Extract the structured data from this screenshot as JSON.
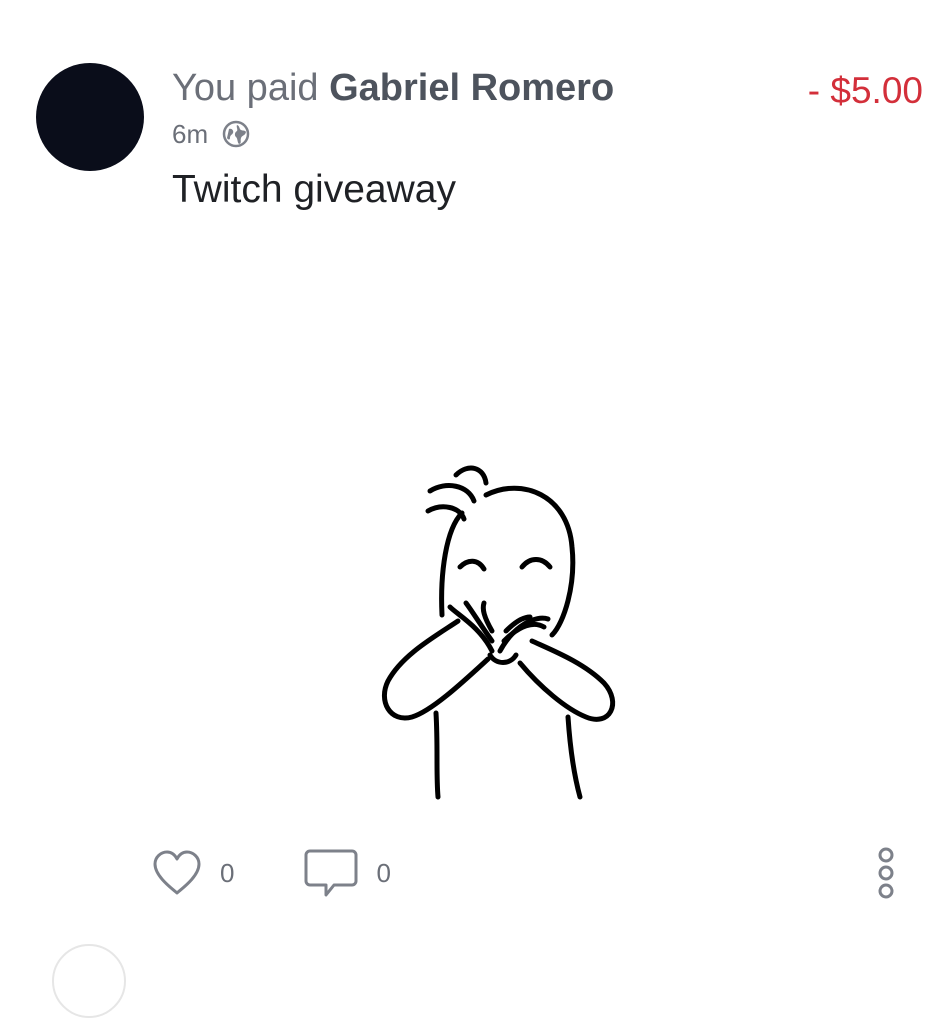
{
  "payment": {
    "verb": "You paid",
    "recipient": "Gabriel Romero",
    "amount": "- $5.00",
    "time": "6m",
    "privacy_icon": "globe-icon",
    "note": "Twitch giveaway",
    "media": "sticker-character-covering-mouth"
  },
  "actions": {
    "like_icon": "heart-icon",
    "like_count": "0",
    "comment_icon": "comment-icon",
    "comment_count": "0",
    "more_icon": "more-vertical-icon"
  },
  "colors": {
    "amount_negative": "#d32f3a",
    "muted_text": "#6b6f78",
    "name_text": "#4d535d",
    "body_text": "#1f2125",
    "avatar": "#0a0d1a"
  }
}
